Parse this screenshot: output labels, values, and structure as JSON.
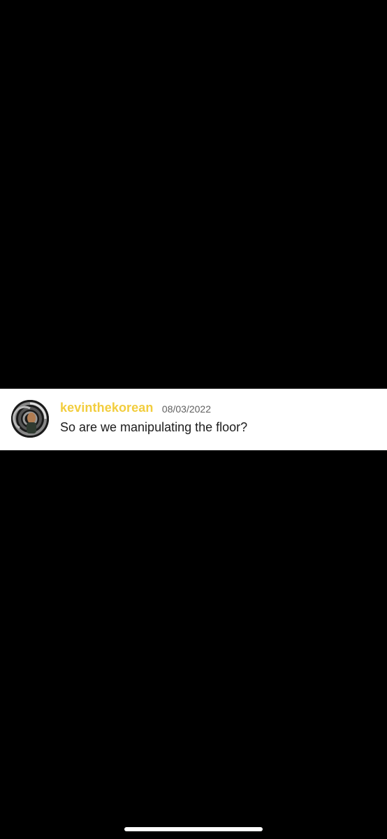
{
  "message": {
    "username": "kevinthekorean",
    "timestamp": "08/03/2022",
    "text": "So are we manipulating the floor?",
    "avatar_icon": "user-avatar-spiral",
    "username_color": "#f2cd3d"
  },
  "system": {
    "home_indicator_icon": "home-indicator-bar"
  }
}
